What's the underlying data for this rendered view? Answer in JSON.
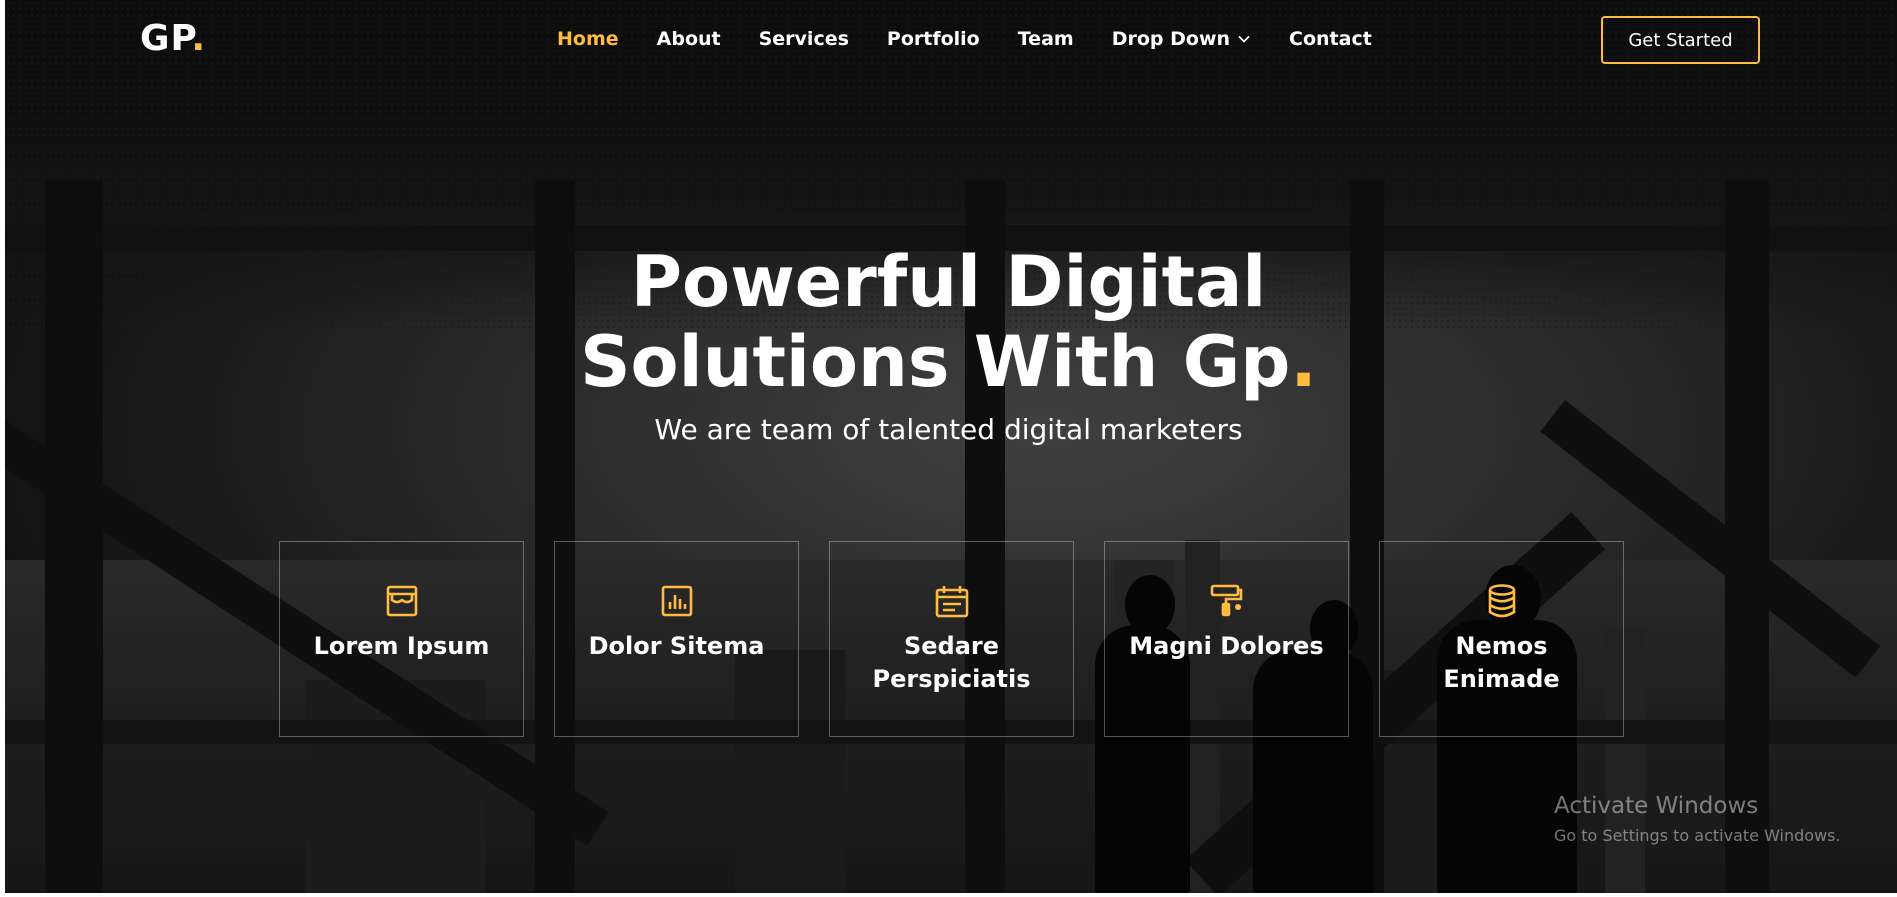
{
  "brand": {
    "name": "GP",
    "dot": ".",
    "accent_color": "#ffbc3f"
  },
  "nav": {
    "items": [
      {
        "label": "Home",
        "active": true
      },
      {
        "label": "About"
      },
      {
        "label": "Services"
      },
      {
        "label": "Portfolio"
      },
      {
        "label": "Team"
      },
      {
        "label": "Drop Down",
        "icon": "chevron-down-icon"
      },
      {
        "label": "Contact"
      }
    ],
    "cta_label": "Get Started"
  },
  "hero": {
    "title_line1": "Powerful Digital",
    "title_line2": "Solutions With Gp",
    "title_dot": ".",
    "subtitle": "We are team of talented digital marketers"
  },
  "features": [
    {
      "label": "Lorem Ipsum",
      "icon": "store-icon"
    },
    {
      "label": "Dolor Sitema",
      "icon": "bar-chart-icon"
    },
    {
      "label": "Sedare Perspiciatis",
      "icon": "calendar-icon"
    },
    {
      "label": "Magni Dolores",
      "icon": "paint-roller-icon"
    },
    {
      "label": "Nemos Enimade",
      "icon": "database-icon"
    }
  ],
  "watermark": {
    "title": "Activate Windows",
    "subtitle": "Go to Settings to activate Windows."
  }
}
